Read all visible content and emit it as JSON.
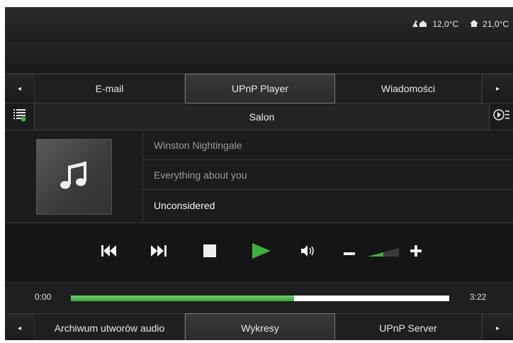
{
  "weather": {
    "outdoor_icon": "outdoor-temperature-icon",
    "outdoor_temp": "12,0°C",
    "indoor_icon": "home-temperature-icon",
    "indoor_temp": "21,0°C"
  },
  "top_tabs": {
    "left_arrow": "◂",
    "right_arrow": "▸",
    "items": [
      {
        "label": "E-mail",
        "active": false
      },
      {
        "label": "UPnP Player",
        "active": true
      },
      {
        "label": "Wiadomości",
        "active": false
      }
    ]
  },
  "room": {
    "playlist_icon": "playlist-icon",
    "name": "Salon",
    "queue_icon": "play-queue-icon"
  },
  "track": {
    "cover_icon": "music-note-icon",
    "artist": "Winston Nightingale",
    "album": "Everything about you",
    "title": "Unconsidered"
  },
  "controls": {
    "previous": "previous-track-icon",
    "next": "next-track-icon",
    "stop": "stop-icon",
    "play": "play-icon",
    "volume": "volume-icon",
    "volume_down": "minus-icon",
    "volume_up": "plus-icon",
    "volume_level": 0.5
  },
  "progress": {
    "elapsed": "0:00",
    "duration": "3:22",
    "fraction": 0.59
  },
  "bottom_tabs": {
    "left_arrow": "◂",
    "right_arrow": "▸",
    "items": [
      {
        "label": "Archiwum utworów audio",
        "active": false
      },
      {
        "label": "Wykresy",
        "active": true
      },
      {
        "label": "UPnP Server",
        "active": false
      }
    ]
  },
  "colors": {
    "accent_green": "#3fb13f",
    "background": "#1b1b1b"
  }
}
